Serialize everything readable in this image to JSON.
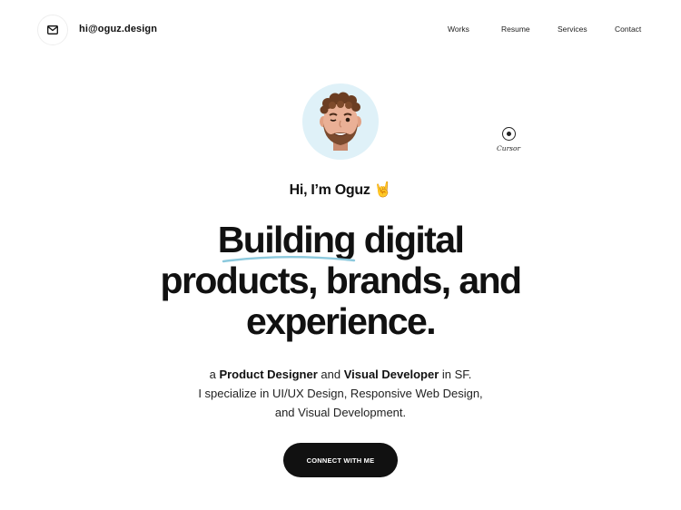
{
  "header": {
    "email": "hi@oguz.design",
    "mail_icon": "mail-icon",
    "nav": [
      "Works",
      "Resume",
      "Services",
      "Contact"
    ]
  },
  "hero": {
    "avatar": "memoji-avatar",
    "cursor_label": "Cursor",
    "greeting_text": "Hi, I’m Oguz",
    "greeting_emoji": "🤘",
    "headline": {
      "highlight": "Building",
      "line1_rest": " digital",
      "line2": "products, brands, and",
      "line3": "experience."
    },
    "description": {
      "l1_a": "a ",
      "l1_role1": "Product Designer",
      "l1_and": " and ",
      "l1_role2": "Visual Developer",
      "l1_end": " in SF.",
      "line2": "I specialize in UI/UX Design, Responsive Web Design,",
      "line3": "and Visual Development."
    },
    "cta_label": "CONNECT WITH ME"
  },
  "colors": {
    "background": "#ffffff",
    "text": "#111111",
    "avatar_bg": "#dff1f8",
    "underline": "#8cc9dd",
    "button": "#111111"
  }
}
